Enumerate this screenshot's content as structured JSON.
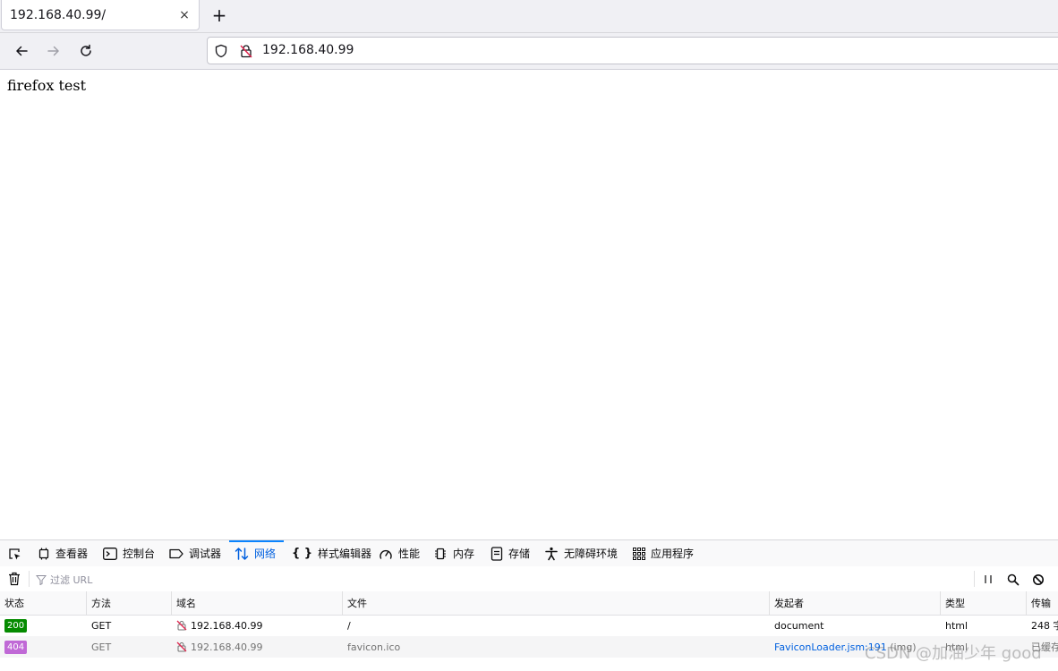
{
  "browser": {
    "tab_title": "192.168.40.99/",
    "tab_close_glyph": "×",
    "new_tab_glyph": "+",
    "url": "192.168.40.99"
  },
  "page": {
    "text": "firefox test"
  },
  "devtools": {
    "tabs": [
      {
        "label": "查看器",
        "icon": "inspector-icon"
      },
      {
        "label": "控制台",
        "icon": "console-icon"
      },
      {
        "label": "调试器",
        "icon": "debugger-icon"
      },
      {
        "label": "网络",
        "icon": "network-icon",
        "active": true
      },
      {
        "label": "样式编辑器",
        "icon": "style-editor-icon"
      },
      {
        "label": "性能",
        "icon": "performance-icon"
      },
      {
        "label": "内存",
        "icon": "memory-icon"
      },
      {
        "label": "存储",
        "icon": "storage-icon"
      },
      {
        "label": "无障碍环境",
        "icon": "accessibility-icon"
      },
      {
        "label": "应用程序",
        "icon": "application-icon"
      }
    ],
    "filter_placeholder": "过滤 URL",
    "columns": [
      "状态",
      "方法",
      "域名",
      "文件",
      "发起者",
      "类型",
      "传输"
    ],
    "rows": [
      {
        "status": "200",
        "status_color": "#058b00",
        "method": "GET",
        "domain": "192.168.40.99",
        "file": "/",
        "initiator": "document",
        "initiator_extra": "",
        "type": "html",
        "transfer": "248 字"
      },
      {
        "status": "404",
        "status_color": "#c069d6",
        "method": "GET",
        "domain": "192.168.40.99",
        "file": "favicon.ico",
        "initiator": "FaviconLoader.jsm:191",
        "initiator_extra": "(img)",
        "type": "html",
        "transfer": "已缓存"
      }
    ]
  },
  "watermark": "CSDN @加油少年 good"
}
